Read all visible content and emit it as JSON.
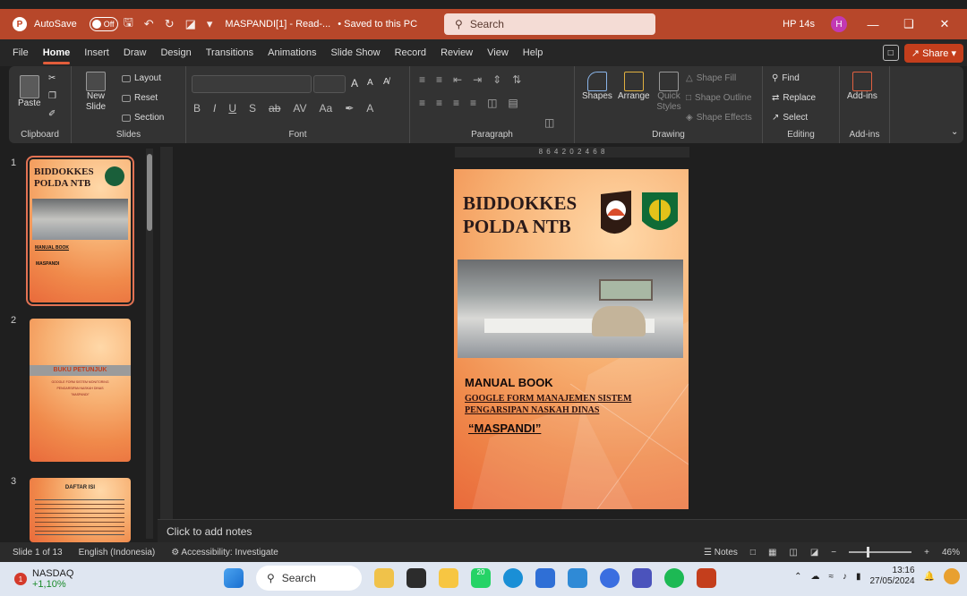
{
  "titlebar": {
    "autosave_label": "AutoSave",
    "autosave_state": "Off",
    "doc_title": "MASPANDI[1] - Read-...",
    "save_status": "• Saved to this PC",
    "search_placeholder": "Search",
    "device_name": "HP 14s",
    "user_initial": "H"
  },
  "menu": {
    "tabs": [
      "File",
      "Home",
      "Insert",
      "Draw",
      "Design",
      "Transitions",
      "Animations",
      "Slide Show",
      "Record",
      "Review",
      "View",
      "Help"
    ],
    "active": "Home",
    "share_label": "Share"
  },
  "ribbon": {
    "clipboard": {
      "paste": "Paste",
      "label": "Clipboard"
    },
    "slides": {
      "new_slide": "New Slide",
      "layout": "Layout",
      "reset": "Reset",
      "section": "Section",
      "label": "Slides"
    },
    "font": {
      "label": "Font"
    },
    "paragraph": {
      "label": "Paragraph"
    },
    "drawing": {
      "shapes": "Shapes",
      "arrange": "Arrange",
      "quick_styles": "Quick Styles",
      "shape_fill": "Shape Fill",
      "shape_outline": "Shape Outline",
      "shape_effects": "Shape Effects",
      "label": "Drawing"
    },
    "editing": {
      "find": "Find",
      "replace": "Replace",
      "select": "Select",
      "label": "Editing"
    },
    "addins": {
      "addins": "Add-ins",
      "label": "Add-ins"
    }
  },
  "ruler": {
    "horizontal": "8 6 4 2 0 2 4 6 8"
  },
  "thumbnails": [
    {
      "num": "1",
      "title1": "BIDDOKKES",
      "title2": "POLDA NTB",
      "line1": "MANUAL BOOK",
      "line2": "MASPANDI"
    },
    {
      "num": "2",
      "title": "BUKU PETUNJUK",
      "line1": "GOOGLE FORM SISTEM MONITORING",
      "line2": "PENGARSIPAN NASKAH DINAS",
      "line3": "\"MASPANDI\""
    },
    {
      "num": "3",
      "title": "DAFTAR ISI"
    }
  ],
  "slide": {
    "title_line1": "BIDDOKKES",
    "title_line2": "POLDA NTB",
    "manual_book": "MANUAL BOOK",
    "google_line1": "GOOGLE FORM MANAJEMEN SISTEM",
    "google_line2": "PENGARSIPAN NASKAH DINAS",
    "maspandi": "“MASPANDI”"
  },
  "notes": {
    "placeholder": "Click to add notes"
  },
  "status": {
    "slide_count": "Slide 1 of 13",
    "language": "English (Indonesia)",
    "accessibility": "Accessibility: Investigate",
    "notes_label": "Notes",
    "zoom": "46%"
  },
  "taskbar": {
    "ticker_name": "NASDAQ",
    "ticker_value": "+1,10%",
    "ticker_badge": "1",
    "search_label": "Search",
    "time": "13:16",
    "date": "27/05/2024",
    "chat_badge": "20"
  },
  "colors": {
    "accent": "#c43e1c",
    "titlebar": "#b7472a"
  }
}
